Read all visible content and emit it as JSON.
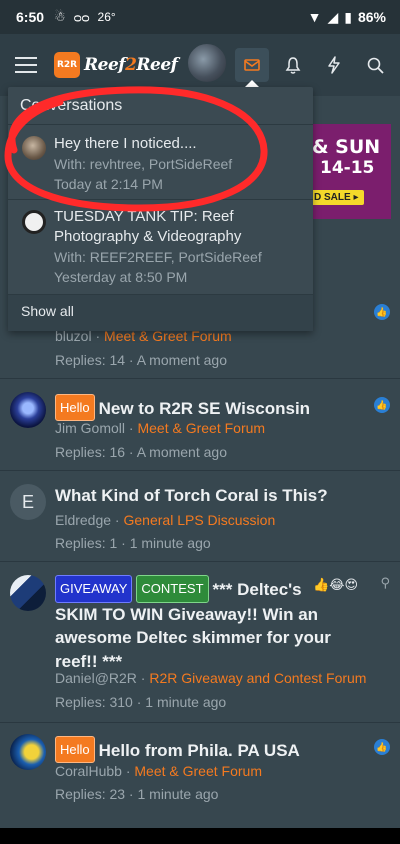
{
  "status_bar": {
    "time": "6:50",
    "temp": "26°",
    "battery": "86%"
  },
  "header": {
    "logo_badge": "R2R",
    "logo_text_a": "Reef",
    "logo_text_b": "2",
    "logo_text_c": "Reef"
  },
  "banner": {
    "line1": "& SUN",
    "line2": "14-15",
    "button": "D SALE ▸"
  },
  "conversations": {
    "title": "Conversations",
    "items": [
      {
        "title": "Hey there I noticed....",
        "with": "With: revhtree, PortSideReef",
        "time": "Today at 2:14 PM"
      },
      {
        "title": "TUESDAY TANK TIP: Reef Photography & Videography",
        "with": "With: REEF2REEF, PortSideReef",
        "time": "Yesterday at 8:50 PM"
      }
    ],
    "show_all": "Show all"
  },
  "threads": [
    {
      "author": "bluzol",
      "forum": "Meet & Greet Forum",
      "stats": "Replies: 14 · A moment ago"
    },
    {
      "label": "Hello",
      "title": "New to R2R SE Wisconsin",
      "author": "Jim Gomoll",
      "forum": "Meet & Greet Forum",
      "stats": "Replies: 16 · A moment ago"
    },
    {
      "avatar_letter": "E",
      "title": "What Kind of Torch Coral is This?",
      "author": "Eldredge",
      "forum": "General LPS Discussion",
      "stats": "Replies: 1 · 1 minute ago"
    },
    {
      "label1": "GIVEAWAY",
      "label2": "CONTEST",
      "title": "*** Deltec's SKIM TO WIN Giveaway!! Win an awesome Deltec skimmer for your reef!! ***",
      "author": "Daniel@R2R",
      "forum": "R2R Giveaway and Contest Forum",
      "stats": "Replies: 310 · 1 minute ago"
    },
    {
      "label": "Hello",
      "title": "Hello from Phila. PA USA",
      "author": "CoralHubb",
      "forum": "Meet & Greet Forum",
      "stats": "Replies: 23 · 1 minute ago"
    }
  ],
  "colors": {
    "accent": "#f47a20",
    "background": "#37474f",
    "header": "#2f3e46",
    "annotation": "#ff2a2a"
  }
}
